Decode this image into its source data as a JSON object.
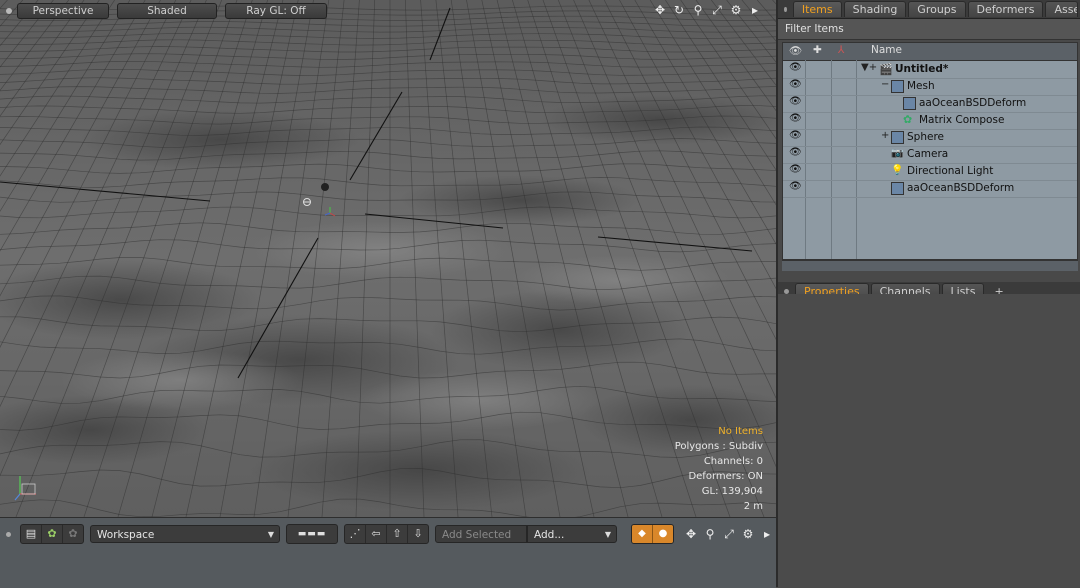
{
  "viewport": {
    "toolbar": {
      "view_mode": "Perspective",
      "shading": "Shaded",
      "raygl": "Ray GL: Off"
    },
    "icons": [
      "move-view-icon",
      "rotate-view-icon",
      "zoom-view-icon",
      "fit-view-icon",
      "gear-icon",
      "expand-arrow-icon"
    ],
    "info": {
      "selection": "No Items",
      "polygons": "Polygons : Subdiv",
      "channels": "Channels: 0",
      "deformers": "Deformers: ON",
      "gl": "GL: 139,904",
      "scale": "2 m"
    }
  },
  "bottom_bar": {
    "workspace": "Workspace",
    "add_selected_placeholder": "Add Selected",
    "add": "Add...",
    "icons": [
      "layout-icon",
      "gear-cog-icon",
      "gear-cog-dim-icon",
      "grid-icon",
      "transform-icon",
      "arrow-left-icon",
      "arrow-up-icon",
      "arrow-down-icon",
      "key-diamond-icon",
      "key-circle-icon"
    ]
  },
  "right_panel": {
    "top_tabs": [
      "Items",
      "Shading",
      "Groups",
      "Deformers",
      "Assembli"
    ],
    "active_top_tab": "Items",
    "filter_label": "Filter Items",
    "tree_header": {
      "name": "Name"
    },
    "tree_items": [
      {
        "label": "Untitled*",
        "bold": true,
        "icon": "scene-clapper-icon"
      },
      {
        "label": "Mesh",
        "icon": "mesh-cube-icon"
      },
      {
        "label": "aaOceanBSDDeform",
        "icon": "deformer-cube-icon"
      },
      {
        "label": "Matrix Compose",
        "icon": "matrix-gear-icon"
      },
      {
        "label": "Sphere",
        "icon": "mesh-cube-icon"
      },
      {
        "label": "Camera",
        "icon": "camera-icon"
      },
      {
        "label": "Directional Light",
        "icon": "light-icon"
      },
      {
        "label": "aaOceanBSDDeform",
        "icon": "deformer-cube-icon"
      }
    ],
    "bottom_tabs": [
      "Properties",
      "Channels",
      "Lists",
      "+"
    ],
    "active_bottom_tab": "Properties"
  },
  "colors": {
    "accent": "#f0a020",
    "info_highlight": "#f0b22a",
    "tree_bg": "#8e9aa3"
  }
}
